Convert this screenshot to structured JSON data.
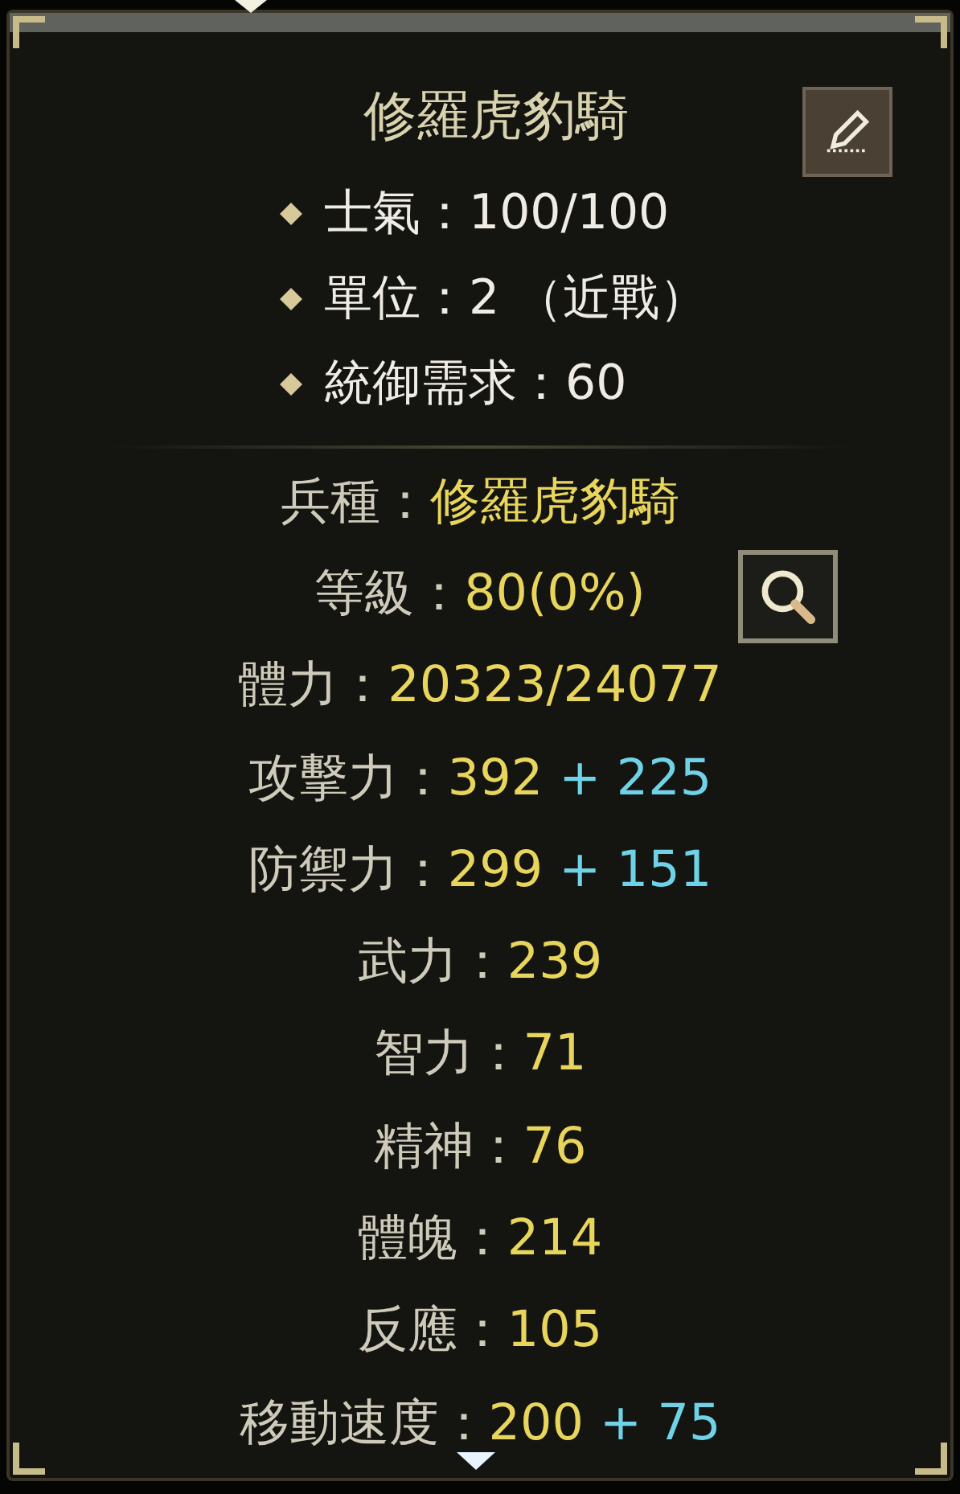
{
  "header": {
    "title": "修羅虎豹騎",
    "lines": [
      "士氣：100/100",
      "單位：2 （近戰）",
      "統御需求：60"
    ]
  },
  "stats": [
    {
      "label": "兵種：",
      "value": "修羅虎豹騎"
    },
    {
      "label": "等級：",
      "value": "80(0%)",
      "kind": "level"
    },
    {
      "label": "體力：",
      "value": "20323/24077"
    },
    {
      "label": "攻擊力：",
      "value": "392",
      "bonus": "+ 225"
    },
    {
      "label": "防禦力：",
      "value": "299",
      "bonus": "+ 151"
    },
    {
      "label": "武力：",
      "value": "239"
    },
    {
      "label": "智力：",
      "value": "71"
    },
    {
      "label": "精神：",
      "value": "76"
    },
    {
      "label": "體魄：",
      "value": "214"
    },
    {
      "label": "反應：",
      "value": "105"
    },
    {
      "label": "移動速度：",
      "value": "200",
      "bonus": "+ 75"
    }
  ]
}
